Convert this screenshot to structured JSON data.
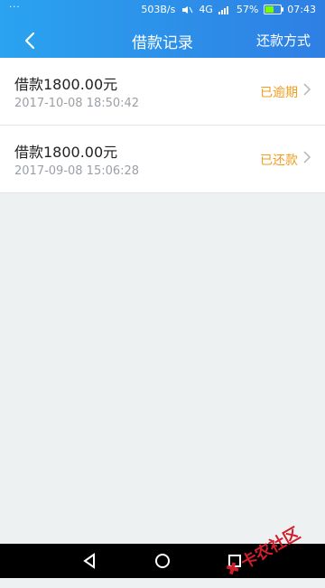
{
  "status_bar": {
    "network_speed": "503B/s",
    "network_label": "4G",
    "battery_percent": "57%",
    "time": "07:43",
    "battery_level": 0.57
  },
  "app_bar": {
    "back_icon": "chevron-left-icon",
    "title": "借款记录",
    "right_action": "还款方式"
  },
  "records": [
    {
      "amount": "借款1800.00元",
      "datetime": "2017-10-08 18:50:42",
      "status": "已逾期"
    },
    {
      "amount": "借款1800.00元",
      "datetime": "2017-09-08 15:06:28",
      "status": "已还款"
    }
  ],
  "colors": {
    "header_start": "#2aa3f0",
    "header_end": "#2f7fe3",
    "status_text": "#f29c1f",
    "background": "#eef1f2"
  },
  "watermark": {
    "text": "卡农社区"
  }
}
